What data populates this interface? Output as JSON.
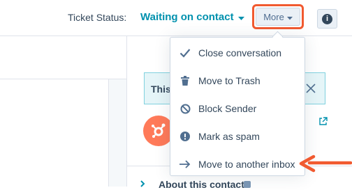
{
  "header": {
    "ticket_status_label": "Ticket Status:",
    "ticket_status_value": "Waiting on contact",
    "more_label": "More",
    "info_icon": "i"
  },
  "menu": {
    "items": [
      {
        "label": "Close conversation",
        "icon": "check-icon"
      },
      {
        "label": "Move to Trash",
        "icon": "trash-icon"
      },
      {
        "label": "Block Sender",
        "icon": "block-icon"
      },
      {
        "label": "Mark as spam",
        "icon": "spam-icon"
      },
      {
        "label": "Move to another inbox",
        "icon": "arrow-right-icon"
      }
    ]
  },
  "right_panel": {
    "card_text": "This",
    "about_label": "About this contact"
  },
  "colors": {
    "accent": "#0091ae",
    "highlight": "#f15a30",
    "hubspot_orange": "#ff7a59",
    "text": "#33475b"
  }
}
